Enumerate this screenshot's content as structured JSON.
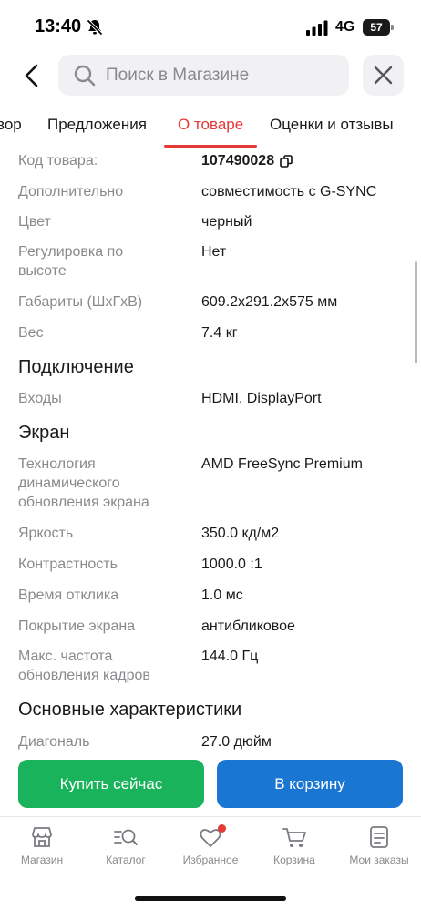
{
  "status_bar": {
    "time": "13:40",
    "network": "4G",
    "battery": "57"
  },
  "search": {
    "placeholder": "Поиск в Магазине"
  },
  "tabs": [
    {
      "label": "вор"
    },
    {
      "label": "Предложения"
    },
    {
      "label": "О товаре",
      "active": true
    },
    {
      "label": "Оценки и отзывы"
    }
  ],
  "specs": {
    "code": {
      "label": "Код товара:",
      "value": "107490028"
    },
    "extra": {
      "label": "Дополнительно",
      "value": "совместимость с G-SYNC"
    },
    "color": {
      "label": "Цвет",
      "value": "черный"
    },
    "height_adjust": {
      "label": "Регулировка по высоте",
      "value": "Нет"
    },
    "dimensions": {
      "label": "Габариты (ШхГхВ)",
      "value": "609.2x291.2x575 мм"
    },
    "weight": {
      "label": "Вес",
      "value": "7.4 кг"
    },
    "connection_title": "Подключение",
    "inputs": {
      "label": "Входы",
      "value": "HDMI, DisplayPort"
    },
    "screen_title": "Экран",
    "sync_tech": {
      "label": "Технология динамического обновления экрана",
      "value": "AMD FreeSync Premium"
    },
    "brightness": {
      "label": "Яркость",
      "value": "350.0 кд/м2"
    },
    "contrast": {
      "label": "Контрастность",
      "value": "1000.0 :1"
    },
    "response": {
      "label": "Время отклика",
      "value": "1.0 мс"
    },
    "coating": {
      "label": "Покрытие экрана",
      "value": "антибликовое"
    },
    "refresh": {
      "label": "Макс. частота обновления кадров",
      "value": "144.0 Гц"
    },
    "main_title": "Основные характеристики",
    "diagonal": {
      "label": "Диагональ",
      "value": "27.0 дюйм"
    }
  },
  "actions": {
    "buy_now": "Купить сейчас",
    "add_to_cart": "В корзину"
  },
  "bottom_nav": [
    {
      "label": "Магазин",
      "icon": "store-icon"
    },
    {
      "label": "Каталог",
      "icon": "catalog-search-icon"
    },
    {
      "label": "Избранное",
      "icon": "heart-icon"
    },
    {
      "label": "Корзина",
      "icon": "cart-icon"
    },
    {
      "label": "Мои заказы",
      "icon": "orders-icon"
    }
  ],
  "colors": {
    "accent": "#e53935",
    "buy": "#18b35a",
    "cart": "#1977d3"
  }
}
